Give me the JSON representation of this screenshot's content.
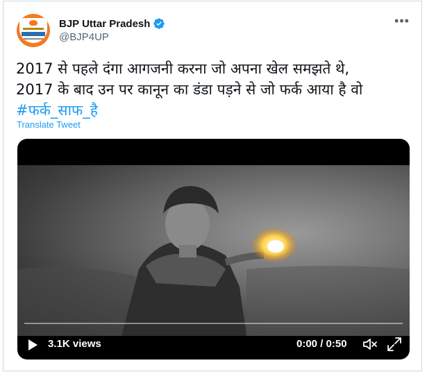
{
  "author": {
    "name": "BJP Uttar Pradesh",
    "handle": "@BJP4UP",
    "avatar_icon": "bjp-logo-avatar",
    "verified_color": "#1d9bf0"
  },
  "menu_icon": "more-horizontal-icon",
  "tweet": {
    "line1": "2017 से पहले दंगा आगजनी करना जो अपना खेल समझते थे,",
    "line2": "2017 के बाद उन पर कानून का डंडा पड़ने से जो फर्क आया है वो",
    "hashtag": "#फर्क_साफ_है",
    "translate_label": "Translate Tweet"
  },
  "video": {
    "views": "3.1K views",
    "time": "0:00 / 0:50",
    "progress": 0
  },
  "colors": {
    "accent": "#1d9bf0",
    "text": "#0f1419",
    "secondary": "#536471"
  }
}
